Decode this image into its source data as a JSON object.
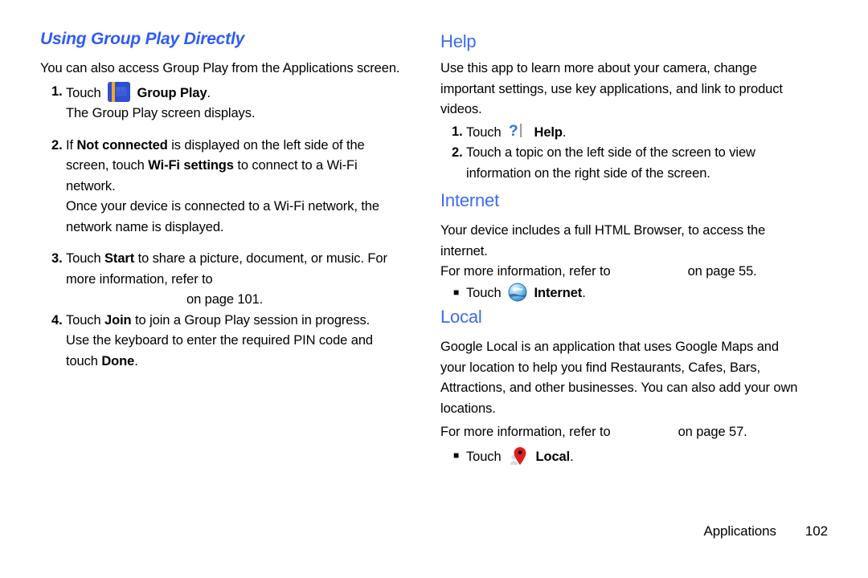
{
  "document": {
    "footer": {
      "chapter": "Applications",
      "page_number": "102"
    }
  },
  "left_column": {
    "heading": "Using Group Play Directly",
    "intro": "You can also access Group Play from the Applications screen.",
    "steps": [
      {
        "number": "1.",
        "text_before": "Touch",
        "icon": "group-play-icon",
        "bold_term": "Group Play",
        "text_after": ".",
        "sub": "The Group Play screen displays."
      },
      {
        "number": "2.",
        "line1_a": "If ",
        "line1_bold": "Not connected",
        "line1_b": " is displayed on the left side of the",
        "line2_a": "screen, touch ",
        "line2_bold": "Wi-Fi settings",
        "line2_b": " to connect to a Wi-Fi",
        "line3": "network.",
        "sub_line1": "Once your device is connected to a Wi-Fi network, the",
        "sub_line2": "network name is displayed."
      },
      {
        "number": "3.",
        "line1_a": "Touch ",
        "line1_bold": "Start",
        "line1_b": " to share a picture, document, or music. For",
        "line2": "more information, refer to",
        "xref_title": "",
        "line3_tail": "on page 101."
      },
      {
        "number": "4.",
        "line1_a": "Touch ",
        "line1_bold": "Join",
        "line1_b": " to join a Group Play session in progress.",
        "line2": "Use the keyboard to enter the required PIN code and",
        "line3_a": "touch ",
        "line3_bold": "Done",
        "line3_b": "."
      }
    ]
  },
  "right_column": {
    "sections": [
      {
        "id": "help",
        "heading": "Help",
        "body_line1": "Use this app to learn more about your camera, change",
        "body_line2": "important settings, use key applications, and link to product",
        "body_line3": "videos.",
        "steps": [
          {
            "number": "1.",
            "text_before": "Touch",
            "icon": "help-icon",
            "bold_term": "Help",
            "text_after": "."
          },
          {
            "number": "2.",
            "line1": "Touch a topic on the left side of the screen to view",
            "line2": "information on the right side of the screen."
          }
        ]
      },
      {
        "id": "internet",
        "heading": "Internet",
        "body_line1": "Your device includes a full HTML Browser, to access the",
        "body_line2": "internet.",
        "refer_prefix": "For more information, refer to",
        "xref_title": "",
        "refer_suffix": "on page 55.",
        "bullet": {
          "marker": "■",
          "text_before": "Touch",
          "icon": "internet-globe-icon",
          "bold_term": "Internet",
          "text_after": "."
        }
      },
      {
        "id": "local",
        "heading": "Local",
        "body_line1": "Google Local is an application that uses Google Maps and",
        "body_line2": "your location to help you find Restaurants, Cafes, Bars,",
        "body_line3": "Attractions, and other businesses. You can also add your own",
        "body_line4": "locations.",
        "refer_prefix": "For more information, refer to",
        "xref_title": "",
        "refer_suffix": "on page 57.",
        "bullet": {
          "marker": "■",
          "text_before": "Touch",
          "icon": "local-pin-icon",
          "bold_term": "Local",
          "text_after": "."
        }
      }
    ]
  },
  "colors": {
    "heading_blue": "#2d5cf5",
    "app_heading_blue": "#3d6bf3",
    "group_play_icon_blue": "#2d4fd0",
    "group_play_icon_orange": "#f7a823",
    "local_pin_red": "#e21b1b",
    "text_black": "#000000"
  }
}
